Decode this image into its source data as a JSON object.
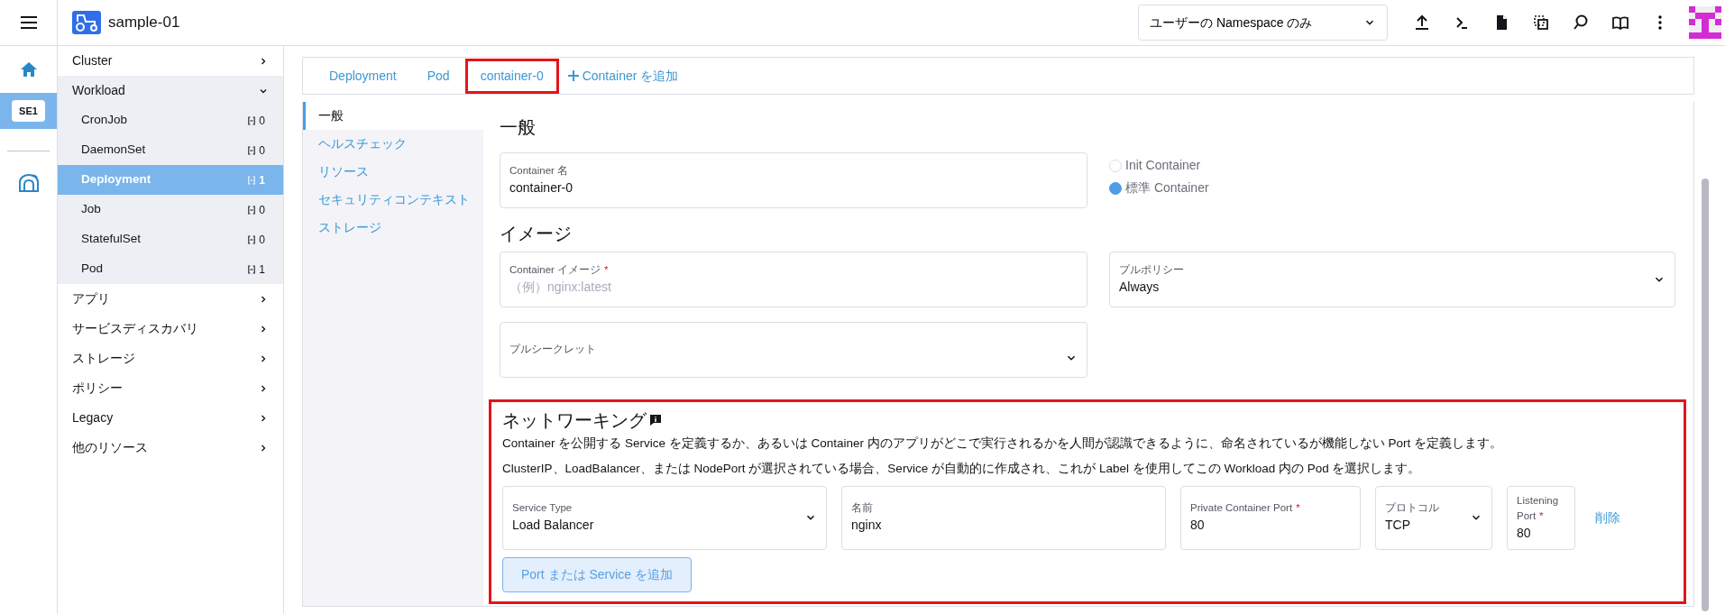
{
  "topbar": {
    "project": "sample-01",
    "namespace_filter": "ユーザーの Namespace のみ"
  },
  "rail": {
    "cluster_badge": {
      "label": "SE1",
      "selected": true
    }
  },
  "sidebar": {
    "items": [
      {
        "label": "Cluster",
        "expanded": false
      },
      {
        "label": "Workload",
        "expanded": true,
        "children": [
          {
            "label": "CronJob",
            "count": "0",
            "selected": false
          },
          {
            "label": "DaemonSet",
            "count": "0",
            "selected": false
          },
          {
            "label": "Deployment",
            "count": "1",
            "selected": true
          },
          {
            "label": "Job",
            "count": "0",
            "selected": false
          },
          {
            "label": "StatefulSet",
            "count": "0",
            "selected": false
          },
          {
            "label": "Pod",
            "count": "1",
            "selected": false
          }
        ]
      },
      {
        "label": "アプリ",
        "expanded": false
      },
      {
        "label": "サービスディスカバリ",
        "expanded": false
      },
      {
        "label": "ストレージ",
        "expanded": false
      },
      {
        "label": "ポリシー",
        "expanded": false
      },
      {
        "label": "Legacy",
        "expanded": false
      },
      {
        "label": "他のリソース",
        "expanded": false
      }
    ]
  },
  "tabs": [
    {
      "label": "Deployment",
      "highlighted": false
    },
    {
      "label": "Pod",
      "highlighted": false
    },
    {
      "label": "container-0",
      "highlighted": true
    }
  ],
  "add_container": "Container を追加",
  "subnav": [
    {
      "label": "一般",
      "selected": true
    },
    {
      "label": "ヘルスチェック",
      "selected": false
    },
    {
      "label": "リソース",
      "selected": false
    },
    {
      "label": "セキュリティコンテキスト",
      "selected": false
    },
    {
      "label": "ストレージ",
      "selected": false
    }
  ],
  "general": {
    "heading": "一般",
    "container_name": {
      "label": "Container 名",
      "value": "container-0"
    },
    "container_type": [
      {
        "label": "Init Container",
        "checked": false
      },
      {
        "label": "標準 Container",
        "checked": true
      }
    ]
  },
  "image": {
    "heading": "イメージ",
    "container_image": {
      "label": "Container イメージ",
      "required_mark": "*",
      "placeholder": "（例）nginx:latest"
    },
    "pull_policy": {
      "label": "プルポリシー",
      "value": "Always"
    },
    "pull_secret": {
      "label": "プルシークレット"
    }
  },
  "networking": {
    "heading": "ネットワーキング",
    "highlighted": true,
    "descriptions": [
      "Container を公開する Service を定義するか、あるいは Container 内のアプリがどこで実行されるかを人間が認識できるように、命名されているが機能しない Port を定義します。",
      "ClusterIP、LoadBalancer、または NodePort が選択されている場合、Service が自動的に作成され、これが Label を使用してこの Workload 内の Pod を選択します。"
    ],
    "fields": [
      {
        "kind": "select",
        "label": "Service Type",
        "value": "Load Balancer"
      },
      {
        "kind": "text",
        "label": "名前",
        "value": "nginx"
      },
      {
        "kind": "text",
        "label": "Private Container Port",
        "value": "80",
        "required_mark": "*"
      },
      {
        "kind": "select",
        "label": "プロトコル",
        "value": "TCP"
      },
      {
        "kind": "text",
        "label": "Listening Port",
        "value": "80",
        "required_mark": "*"
      }
    ],
    "remove": "削除",
    "add_button": "Port または Service を追加"
  }
}
